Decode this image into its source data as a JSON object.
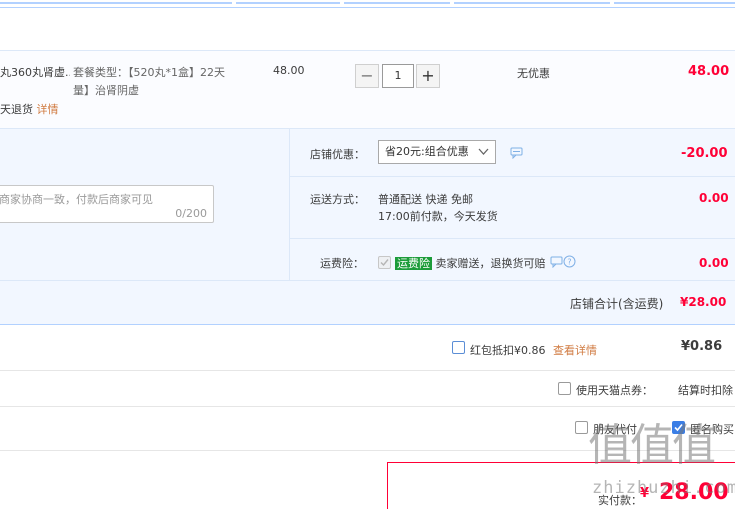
{
  "item": {
    "title": "丸360丸肾虚...",
    "sku_label": "套餐类型：【520丸*1盒】22天量】治肾阴虚",
    "return_text": "天退货",
    "detail_link": "详情",
    "unit_price": "48.00",
    "quantity": "1",
    "discount": "无优惠",
    "subtotal": "48.00",
    "minus_label": "−",
    "plus_label": "+"
  },
  "memo": {
    "placeholder": "商家协商一致，付款后商家可见",
    "counter": "0/200"
  },
  "shop_discount": {
    "label": "店铺优惠：",
    "selected": "省20元:组合优惠",
    "amount": "-20.00"
  },
  "shipping": {
    "label": "运送方式：",
    "method": "普通配送 快递 免邮",
    "note": "17:00前付款，今天发货",
    "amount": "0.00"
  },
  "insurance": {
    "label": "运费险：",
    "tag": "运费险",
    "text": "卖家赠送，退换货可赔",
    "amount": "0.00"
  },
  "shop_total": {
    "label": "店铺合计(含运费)",
    "amount": "¥28.00"
  },
  "red_packet": {
    "label": "红包抵扣¥0.86",
    "link": "查看详情",
    "amount": "¥0.86"
  },
  "tmall_points": {
    "label": "使用天猫点券：",
    "value": "结算时扣除"
  },
  "options": {
    "friend_pay": "朋友代付",
    "anonymous": "匿名购买"
  },
  "payment": {
    "label": "实付款：",
    "currency": "¥",
    "amount": "28.00"
  },
  "watermark": {
    "logo": "值值值",
    "site": "zhizhuzhi.com"
  },
  "colors": {
    "accent_red": "#ff0036",
    "header_blue": "#b2d1ff",
    "panel_blue": "#f2f7ff",
    "link_orange": "#d07a40",
    "tag_green": "#1c9c3a"
  }
}
